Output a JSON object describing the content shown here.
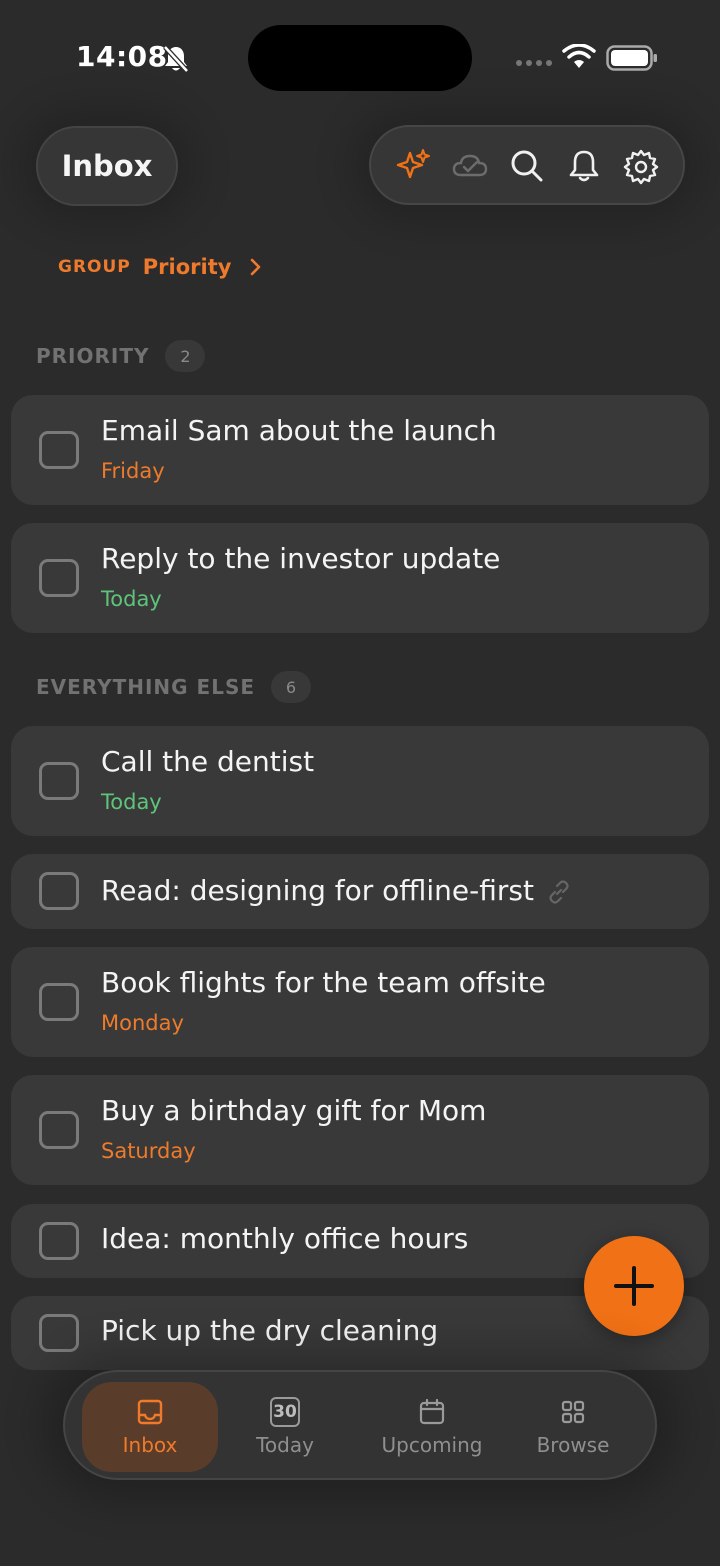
{
  "status_bar": {
    "time": "14:08"
  },
  "header": {
    "title": "Inbox"
  },
  "toolbar": {
    "buttons": [
      "sparkles-icon",
      "cloud-check-icon",
      "search-icon",
      "bell-icon",
      "gear-icon"
    ]
  },
  "group": {
    "label": "GROUP",
    "value": "Priority"
  },
  "sections": [
    {
      "title": "PRIORITY",
      "count": "2",
      "tasks": [
        {
          "title": "Email Sam about the launch",
          "date": "Friday",
          "date_color": "orange"
        },
        {
          "title": "Reply to the investor update",
          "date": "Today",
          "date_color": "green"
        }
      ]
    },
    {
      "title": "EVERYTHING ELSE",
      "count": "6",
      "tasks": [
        {
          "title": "Call the dentist",
          "date": "Today",
          "date_color": "green"
        },
        {
          "title": "Read: designing for offline-first",
          "date": "",
          "has_link": true
        },
        {
          "title": "Book flights for the team offsite",
          "date": "Monday",
          "date_color": "orange"
        },
        {
          "title": "Buy a birthday gift for Mom",
          "date": "Saturday",
          "date_color": "orange"
        },
        {
          "title": "Idea: monthly office hours",
          "date": ""
        },
        {
          "title": "Pick up the dry cleaning",
          "date": ""
        }
      ]
    }
  ],
  "bottom_nav": {
    "tabs": [
      {
        "label": "Inbox",
        "icon": "inbox-tray-icon",
        "active": true
      },
      {
        "label": "Today",
        "icon": "calendar-day-icon",
        "badge": "30",
        "active": false
      },
      {
        "label": "Upcoming",
        "icon": "calendar-icon",
        "active": false
      },
      {
        "label": "Browse",
        "icon": "grid-icon",
        "active": false
      }
    ]
  },
  "colors": {
    "accent": "#f07116",
    "date_orange": "#ee7b2b",
    "date_green": "#5fc47b",
    "background": "#2b2b2b",
    "card": "#393939"
  }
}
